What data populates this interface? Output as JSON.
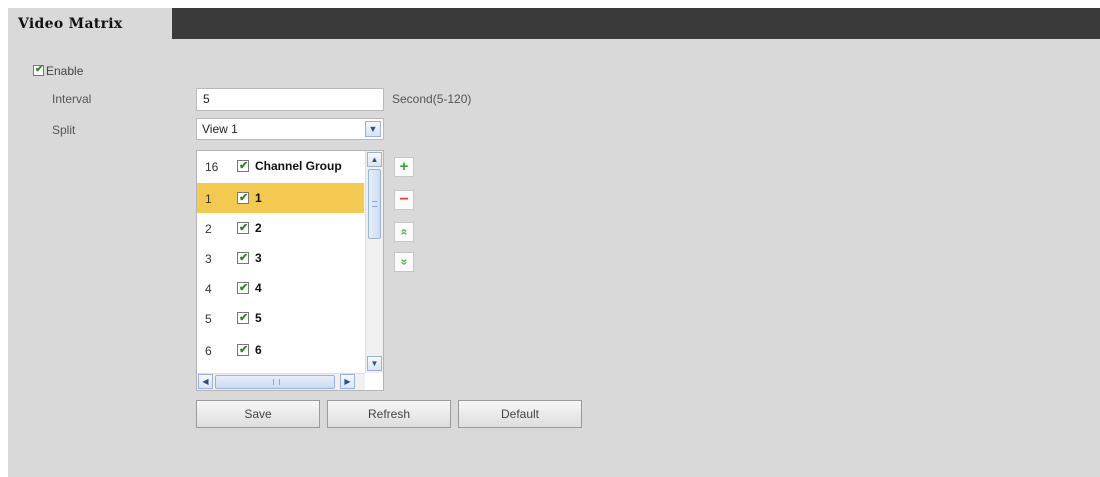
{
  "tab": {
    "title": "Video Matrix"
  },
  "enable": {
    "label": "Enable",
    "checked": true
  },
  "interval": {
    "label": "Interval",
    "value": "5",
    "unit": "Second(5-120)"
  },
  "split": {
    "label": "Split",
    "value": "View 1"
  },
  "channel_list": {
    "header": {
      "num": "16",
      "name": "Channel Group"
    },
    "rows": [
      {
        "num": "1",
        "name": "1",
        "selected": true
      },
      {
        "num": "2",
        "name": "2"
      },
      {
        "num": "3",
        "name": "3"
      },
      {
        "num": "4",
        "name": "4"
      },
      {
        "num": "5",
        "name": "5"
      },
      {
        "num": "6",
        "name": "6"
      }
    ]
  },
  "list_actions": {
    "add": "+",
    "remove": "−",
    "move_up": "«",
    "move_down": "»"
  },
  "buttons": {
    "save": "Save",
    "refresh": "Refresh",
    "default": "Default"
  },
  "colors": {
    "selected_row": "#f3c94f",
    "header_bar": "#3a3a3a",
    "panel_bg": "#d9d9d9",
    "add_green": "#3aa43a",
    "remove_red": "#e43a3a"
  }
}
